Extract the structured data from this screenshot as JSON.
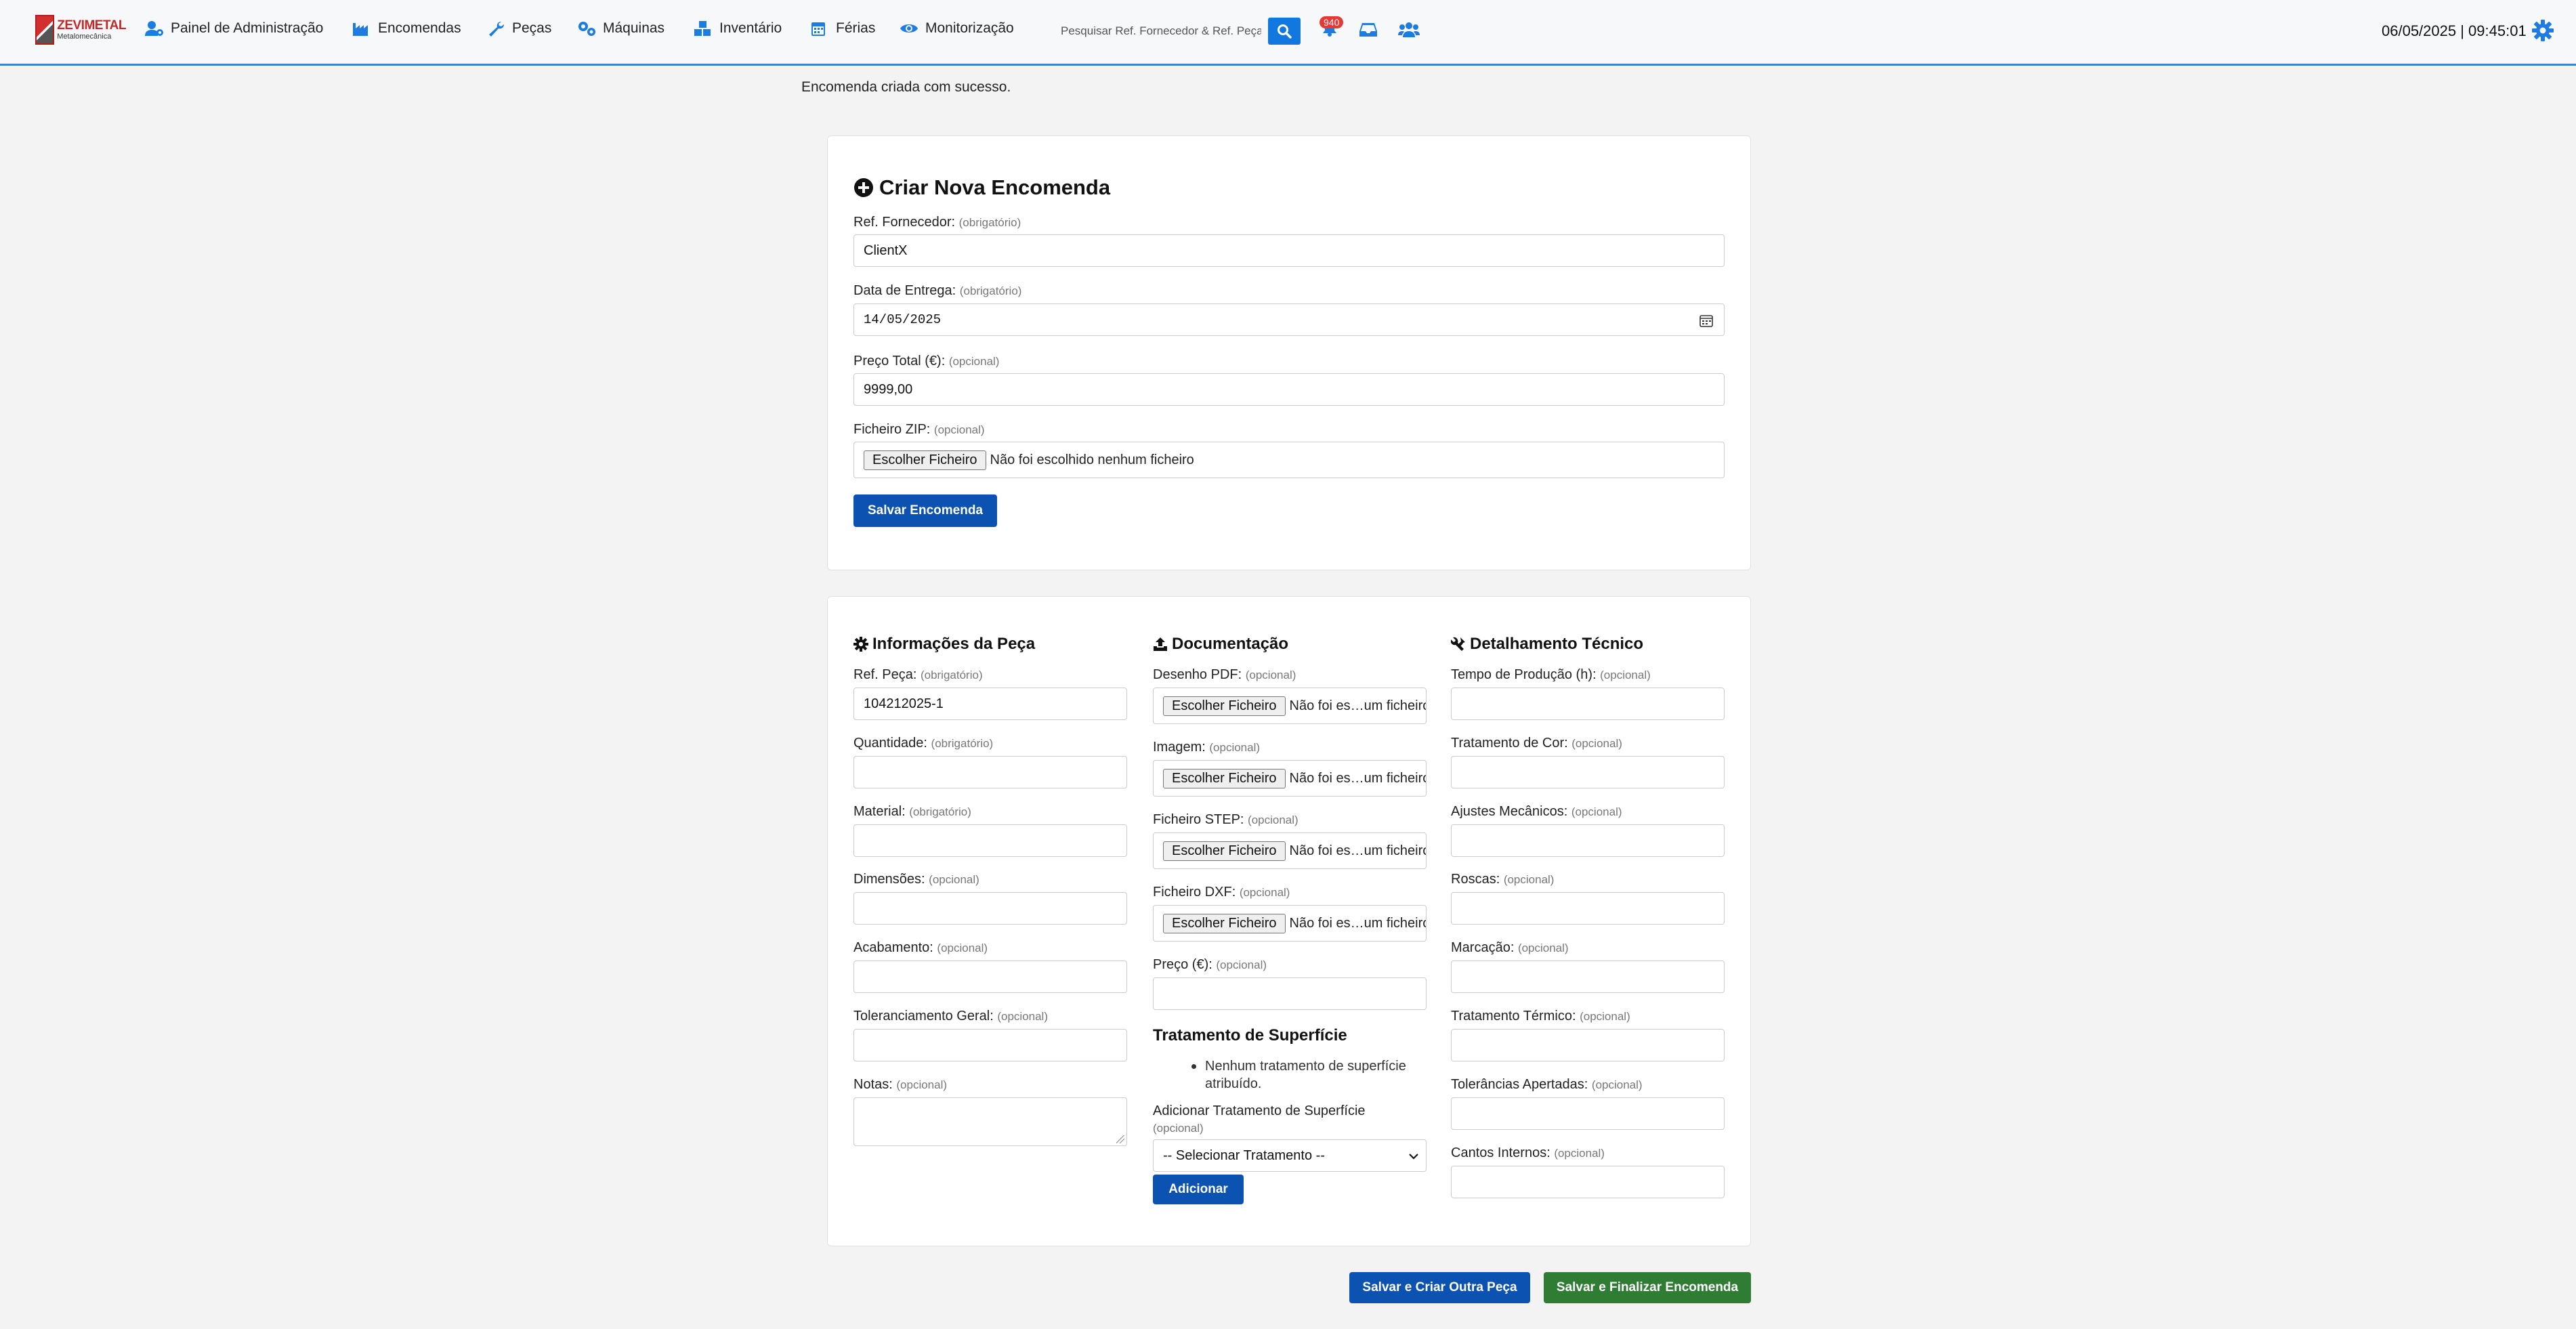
{
  "brand": {
    "name": "ZEVIMETAL",
    "tagline": "Metalomecânica"
  },
  "nav": {
    "items": [
      {
        "label": "Painel de Administração",
        "icon": "user-gear-icon"
      },
      {
        "label": "Encomendas",
        "icon": "industry-icon"
      },
      {
        "label": "Peças",
        "icon": "wrench-icon"
      },
      {
        "label": "Máquinas",
        "icon": "cogs-icon"
      },
      {
        "label": "Inventário",
        "icon": "boxes-icon"
      },
      {
        "label": "Férias",
        "icon": "calendar-icon"
      },
      {
        "label": "Monitorização",
        "icon": "eye-icon"
      }
    ],
    "search_placeholder": "Pesquisar Ref. Fornecedor & Ref. Peça",
    "notification_count": "940",
    "datetime": "06/05/2025  | 09:45:01"
  },
  "flash": {
    "message": "Encomenda criada com sucesso."
  },
  "order_form": {
    "title": "Criar Nova Encomenda",
    "supplier_ref": {
      "label": "Ref. Fornecedor:",
      "hint": "(obrigatório)",
      "value": "ClientX"
    },
    "delivery_date": {
      "label": "Data de Entrega:",
      "hint": "(obrigatório)",
      "value": "14/05/2025"
    },
    "total_price": {
      "label": "Preço Total (€):",
      "hint": "(opcional)",
      "value": "9999,00"
    },
    "zip_file": {
      "label": "Ficheiro ZIP:",
      "hint": "(opcional)",
      "button": "Escolher Ficheiro",
      "status": "Não foi escolhido nenhum ficheiro"
    },
    "save_label": "Salvar Encomenda"
  },
  "part_form": {
    "info": {
      "title": "Informações da Peça",
      "fields": [
        {
          "label": "Ref. Peça:",
          "hint": "(obrigatório)",
          "value": "104212025-1"
        },
        {
          "label": "Quantidade:",
          "hint": "(obrigatório)",
          "value": ""
        },
        {
          "label": "Material:",
          "hint": "(obrigatório)",
          "value": ""
        },
        {
          "label": "Dimensões:",
          "hint": "(opcional)",
          "value": ""
        },
        {
          "label": "Acabamento:",
          "hint": "(opcional)",
          "value": ""
        },
        {
          "label": "Toleranciamento Geral:",
          "hint": "(opcional)",
          "value": ""
        },
        {
          "label": "Notas:",
          "hint": "(opcional)",
          "value": ""
        }
      ]
    },
    "docs": {
      "title": "Documentação",
      "file_button": "Escolher Ficheiro",
      "file_status": "Não foi es…um ficheiro",
      "files": [
        {
          "label": "Desenho PDF:",
          "hint": "(opcional)"
        },
        {
          "label": "Imagem:",
          "hint": "(opcional)"
        },
        {
          "label": "Ficheiro STEP:",
          "hint": "(opcional)"
        },
        {
          "label": "Ficheiro DXF:",
          "hint": "(opcional)"
        }
      ],
      "price": {
        "label": "Preço (€):",
        "hint": "(opcional)",
        "value": ""
      },
      "surface": {
        "title": "Tratamento de Superfície",
        "empty_item": "Nenhum tratamento de superfície atribuído.",
        "add_label": "Adicionar Tratamento de Superfície",
        "add_hint": "(opcional)",
        "select_value": "-- Selecionar Tratamento --",
        "add_button": "Adicionar"
      }
    },
    "tech": {
      "title": "Detalhamento Técnico",
      "fields": [
        {
          "label": "Tempo de Produção (h):",
          "hint": "(opcional)",
          "value": ""
        },
        {
          "label": "Tratamento de Cor:",
          "hint": "(opcional)",
          "value": ""
        },
        {
          "label": "Ajustes Mecânicos:",
          "hint": "(opcional)",
          "value": ""
        },
        {
          "label": "Roscas:",
          "hint": "(opcional)",
          "value": ""
        },
        {
          "label": "Marcação:",
          "hint": "(opcional)",
          "value": ""
        },
        {
          "label": "Tratamento Térmico:",
          "hint": "(opcional)",
          "value": ""
        },
        {
          "label": "Tolerâncias Apertadas:",
          "hint": "(opcional)",
          "value": ""
        },
        {
          "label": "Cantos Internos:",
          "hint": "(opcional)",
          "value": ""
        }
      ]
    }
  },
  "actions": {
    "save_and_new": "Salvar e Criar Outra Peça",
    "save_and_finish": "Salvar e Finalizar Encomenda"
  },
  "colors": {
    "accent": "#1e7be0",
    "primary_button": "#0b52b1",
    "success_button": "#2e7d32",
    "badge": "#e53935"
  }
}
